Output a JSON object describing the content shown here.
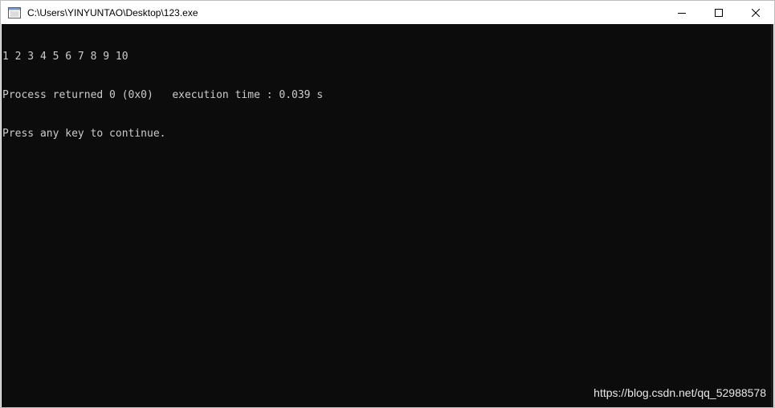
{
  "window": {
    "title": "C:\\Users\\YINYUNTAO\\Desktop\\123.exe",
    "icon": "console-app-icon",
    "controls": {
      "minimize_icon": "minimize-icon",
      "maximize_icon": "maximize-icon",
      "close_icon": "close-icon"
    }
  },
  "console": {
    "background": "#0c0c0c",
    "foreground": "#cccccc",
    "lines": [
      "1 2 3 4 5 6 7 8 9 10",
      "Process returned 0 (0x0)   execution time : 0.039 s",
      "Press any key to continue."
    ]
  },
  "watermark": "https://blog.csdn.net/qq_52988578"
}
